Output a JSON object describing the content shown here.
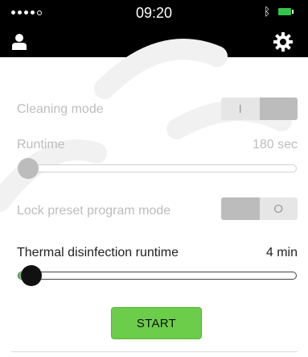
{
  "status_bar": {
    "time": "09:20",
    "signal_icon": "signal-dots-icon",
    "bluetooth_icon": "ᛒ",
    "battery_color": "#33c44a"
  },
  "nav": {
    "user_icon": "user-icon",
    "settings_icon": "gear-icon"
  },
  "cleaning": {
    "label": "Cleaning mode",
    "toggle_left": "I",
    "toggle_right": "",
    "state": "on"
  },
  "runtime": {
    "label": "Runtime",
    "value": "180 sec",
    "slider_fraction": 0.0
  },
  "lock": {
    "label": "Lock preset program mode",
    "toggle_left": "",
    "toggle_right": "O",
    "state": "off"
  },
  "thermal": {
    "label": "Thermal disinfection runtime",
    "value": "4 min",
    "slider_fraction": 0.03
  },
  "start_button": {
    "label": "START",
    "color": "#6ccd4a"
  }
}
